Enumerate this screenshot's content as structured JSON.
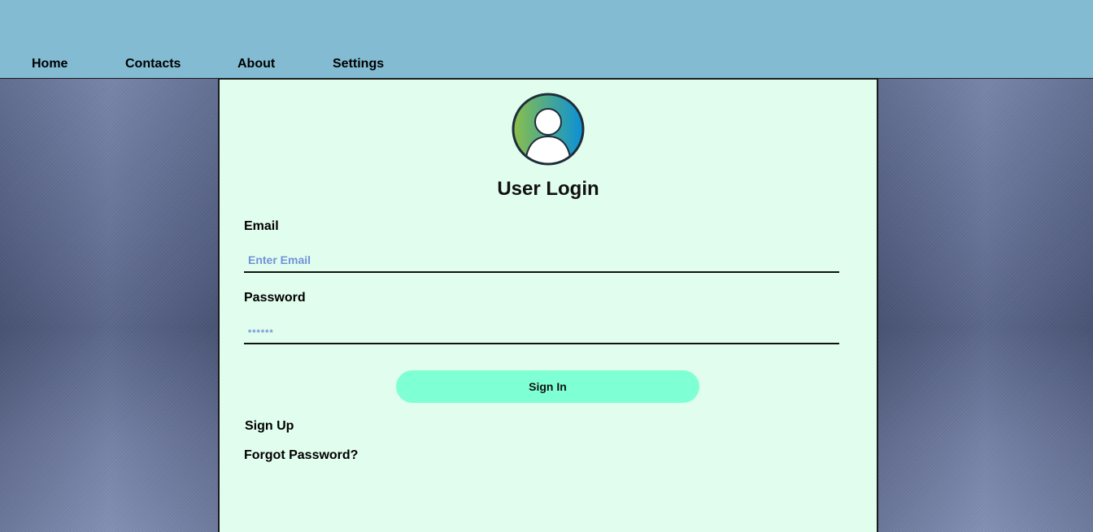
{
  "nav": {
    "items": [
      {
        "label": "Home"
      },
      {
        "label": "Contacts"
      },
      {
        "label": "About"
      },
      {
        "label": "Settings"
      }
    ]
  },
  "login": {
    "avatar_icon": "user-avatar-icon",
    "title": "User Login",
    "email_label": "Email",
    "email_placeholder": "Enter Email",
    "email_value": "",
    "password_label": "Password",
    "password_placeholder": "******",
    "password_value": "",
    "signin_label": "Sign In",
    "signup_label": "Sign Up",
    "forgot_label": "Forgot Password?"
  },
  "colors": {
    "topbar": "#82bbd2",
    "panel": "#e1fdee",
    "button": "#7fffd4",
    "placeholder": "#6f93d8",
    "avatar_gradient_start": "#8bbf4a",
    "avatar_gradient_end": "#0a90d8"
  }
}
